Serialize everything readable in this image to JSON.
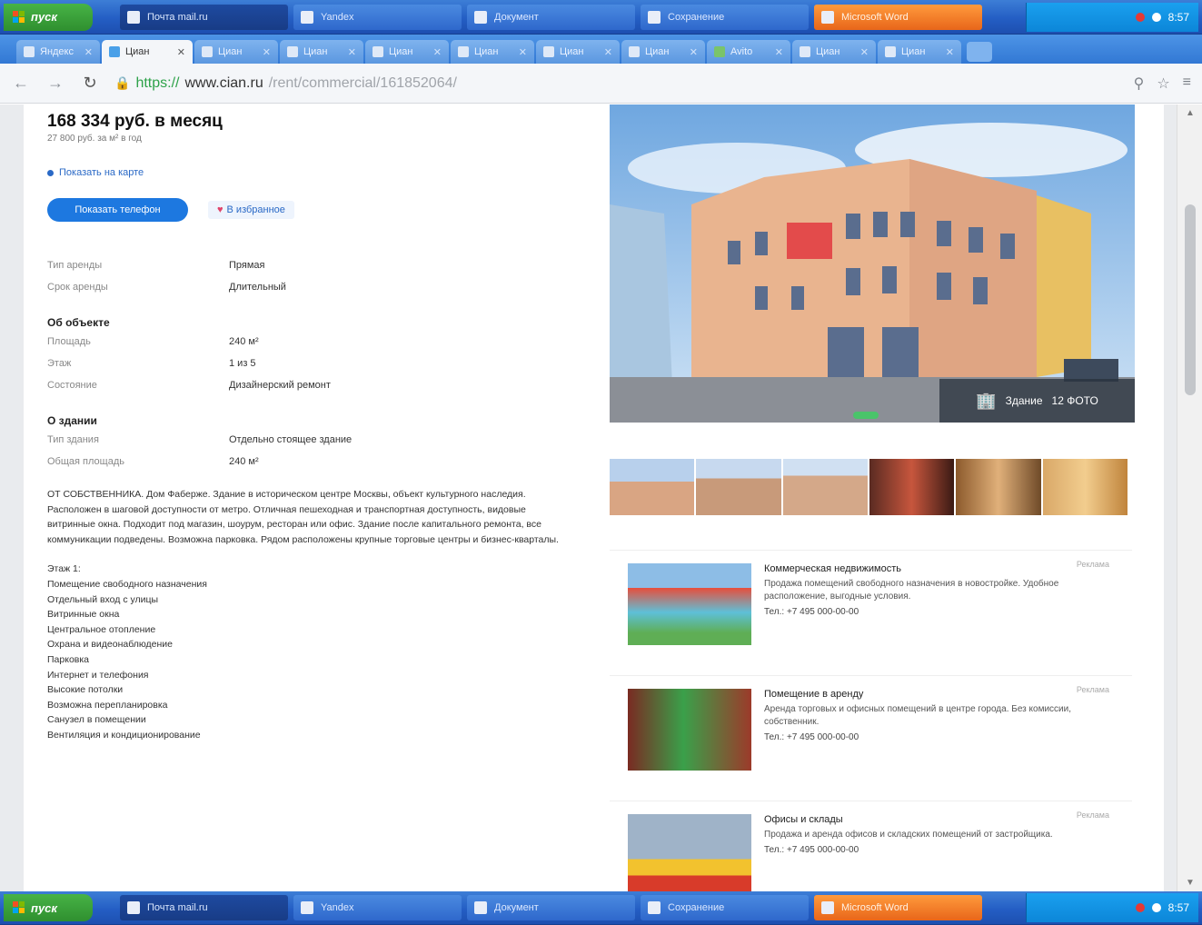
{
  "taskbar": {
    "start_label": "пуск",
    "items": [
      {
        "label": "Почта mail.ru",
        "style": "active"
      },
      {
        "label": "Yandex",
        "style": ""
      },
      {
        "label": "Документ",
        "style": ""
      },
      {
        "label": "Сохранение",
        "style": ""
      },
      {
        "label": "Microsoft Word",
        "style": "orange"
      }
    ],
    "clock": "8:57"
  },
  "browser": {
    "tabs": [
      {
        "label": "Яндекс"
      },
      {
        "label": "Циан",
        "active": true
      },
      {
        "label": "Циан"
      },
      {
        "label": "Циан"
      },
      {
        "label": "Циан"
      },
      {
        "label": "Циан"
      },
      {
        "label": "Циан"
      },
      {
        "label": "Циан"
      },
      {
        "label": "Avito"
      },
      {
        "label": "Циан"
      },
      {
        "label": "Циан"
      }
    ],
    "url_https": "https://",
    "url_host": "www.cian.ru",
    "url_path": "/rent/commercial/161852064/"
  },
  "listing": {
    "price": "168 334 руб. в месяц",
    "price_sub": "27 800 руб. за м² в год",
    "map_link": "Показать на карте",
    "phone_button": "Показать телефон",
    "favorite_button": "В избранное",
    "basic": [
      {
        "k": "Тип аренды",
        "v": "Прямая"
      },
      {
        "k": "Срок аренды",
        "v": "Длительный"
      }
    ],
    "object_title": "Об объекте",
    "object": [
      {
        "k": "Площадь",
        "v": "240 м²"
      },
      {
        "k": "Этаж",
        "v": "1 из 5"
      },
      {
        "k": "Состояние",
        "v": "Дизайнерский ремонт"
      }
    ],
    "building_title": "О здании",
    "building": [
      {
        "k": "Тип здания",
        "v": "Отдельно стоящее здание"
      },
      {
        "k": "Общая площадь",
        "v": "240 м²"
      }
    ],
    "description": "ОТ СОБСТВЕННИКА. Дом Фаберже. Здание в историческом центре Москвы, объект культурного наследия. Расположен в шаговой доступности от метро. Отличная пешеходная и транспортная доступность, видовые витринные окна. Подходит под магазин, шоурум, ресторан или офис. Здание после капитального ремонта, все коммуникации подведены. Возможна парковка. Рядом расположены крупные торговые центры и бизнес-кварталы.",
    "features_title": "Этаж 1:",
    "features": [
      "Помещение свободного назначения",
      "Отдельный вход с улицы",
      "Витринные окна",
      "Центральное отопление",
      "Охрана и видеонаблюдение",
      "Парковка",
      "Интернет и телефония",
      "Высокие потолки",
      "Возможна перепланировка",
      "Санузел в помещении",
      "Вентиляция и кондиционирование"
    ]
  },
  "gallery": {
    "badge_label": "Здание",
    "badge_count": "12 ФОТО"
  },
  "ads": [
    {
      "title": "Коммерческая недвижимость",
      "text": "Продажа помещений свободного назначения в новостройке. Удобное расположение, выгодные условия.",
      "tel": "Тел.: +7 495 000-00-00",
      "tag": "Реклама"
    },
    {
      "title": "Помещение в аренду",
      "text": "Аренда торговых и офисных помещений в центре города. Без комиссии, собственник.",
      "tel": "Тел.: +7 495 000-00-00",
      "tag": "Реклама"
    },
    {
      "title": "Офисы и склады",
      "text": "Продажа и аренда офисов и складских помещений от застройщика.",
      "tel": "Тел.: +7 495 000-00-00",
      "tag": "Реклама"
    }
  ]
}
